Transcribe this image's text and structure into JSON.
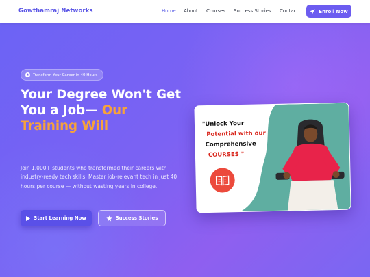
{
  "nav": {
    "brand": "Gowthamraj Networks",
    "links": [
      {
        "label": "Home",
        "active": true
      },
      {
        "label": "About",
        "active": false
      },
      {
        "label": "Courses",
        "active": false
      },
      {
        "label": "Success Stories",
        "active": false
      },
      {
        "label": "Contact",
        "active": false
      }
    ],
    "enroll_label": "Enroll Now",
    "enroll_icon": "paper-plane-icon"
  },
  "hero": {
    "badge": "Transform Your Career in 40 Hours",
    "badge_icon": "rocket-icon",
    "headline_line1": "Your Degree Won't Get",
    "headline_line2_prefix": "You a Job— ",
    "headline_line2_accent": "Our",
    "headline_line3_accent": "Training Will",
    "description": "Join 1,000+ students who transformed their careers with industry-ready tech skills. Master job-relevant tech in just 40 hours per course — without wasting years in college.",
    "primary_button": "Start Learning Now",
    "primary_icon": "play-icon",
    "secondary_button": "Success Stories",
    "secondary_icon": "star-icon"
  },
  "promo_card": {
    "line1": "\"Unlock Your",
    "line2": "Potential with our",
    "line3": "Comprehensive",
    "line4": "COURSES \"",
    "icon": "book-icon"
  },
  "colors": {
    "brand": "#5b56e6",
    "accent": "#f7a23b",
    "teal": "#5faea1",
    "promo_red": "#d9261c"
  }
}
